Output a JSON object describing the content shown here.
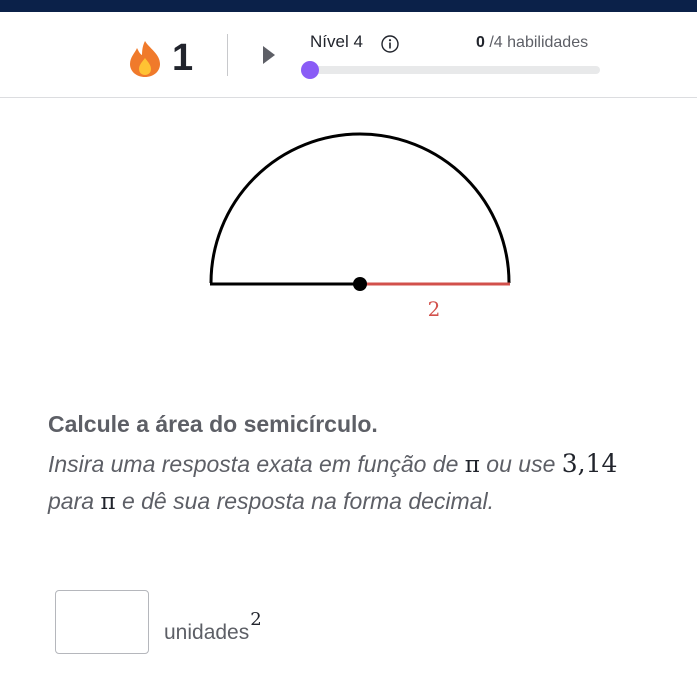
{
  "header": {
    "streak_count": "1",
    "level_label": "Nível 4",
    "skills_done": "0",
    "skills_total": " /4 habilidades",
    "progress_fraction": 0
  },
  "figure": {
    "radius_label": "2"
  },
  "question": {
    "title": "Calcule a área do semicírculo.",
    "instruction_part1": "Insira uma resposta exata em função de ",
    "pi_symbol": "π",
    "instruction_part2": " ou use ",
    "approx_value": "3,14",
    "instruction_part3": "para ",
    "instruction_part4": " e dê sua resposta na forma decimal."
  },
  "answer": {
    "value": "",
    "placeholder": "",
    "unit": "unidades",
    "unit_exponent": "2"
  },
  "colors": {
    "top_bar": "#0b2149",
    "flame_outer": "#f07a2b",
    "flame_inner": "#ffc233",
    "progress_dot": "#8a5cf6",
    "radius_line": "#d2504b",
    "text_muted": "#5d5f66"
  },
  "icons": {
    "streak": "flame-icon",
    "play": "play-icon",
    "info": "info-icon"
  }
}
